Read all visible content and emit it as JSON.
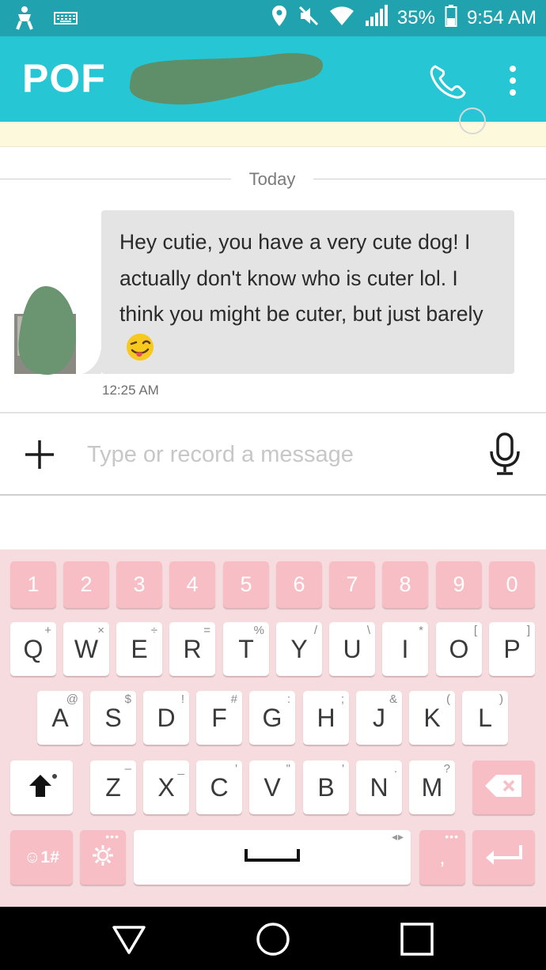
{
  "status_bar": {
    "battery": "35%",
    "time": "9:54 AM",
    "icons": [
      "figure-icon",
      "keyboard-icon",
      "location-icon",
      "mute-icon",
      "wifi-icon",
      "signal-icon",
      "battery-icon"
    ]
  },
  "app_bar": {
    "logo": "POF",
    "icons": [
      "phone-icon",
      "more-vert-icon"
    ]
  },
  "conversation": {
    "date_label": "Today",
    "messages": [
      {
        "text": "Hey cutie, you have a very cute dog! I actually don't know who is cuter lol. I think you might be cuter, but just barely",
        "emoji": "winking-face-with-tongue-emoji",
        "time": "12:25 AM"
      }
    ]
  },
  "compose": {
    "placeholder": "Type or record a message",
    "icons": [
      "plus-icon",
      "microphone-icon"
    ]
  },
  "keyboard": {
    "number_row": [
      "1",
      "2",
      "3",
      "4",
      "5",
      "6",
      "7",
      "8",
      "9",
      "0"
    ],
    "row1": [
      {
        "label": "Q",
        "hint": "+"
      },
      {
        "label": "W",
        "hint": "×"
      },
      {
        "label": "E",
        "hint": "÷"
      },
      {
        "label": "R",
        "hint": "="
      },
      {
        "label": "T",
        "hint": "%"
      },
      {
        "label": "Y",
        "hint": "/"
      },
      {
        "label": "U",
        "hint": "\\"
      },
      {
        "label": "I",
        "hint": "*"
      },
      {
        "label": "O",
        "hint": "["
      },
      {
        "label": "P",
        "hint": "]"
      }
    ],
    "row2": [
      {
        "label": "A",
        "hint": "@"
      },
      {
        "label": "S",
        "hint": "$"
      },
      {
        "label": "D",
        "hint": "!"
      },
      {
        "label": "F",
        "hint": "#"
      },
      {
        "label": "G",
        "hint": ":"
      },
      {
        "label": "H",
        "hint": ";"
      },
      {
        "label": "J",
        "hint": "&"
      },
      {
        "label": "K",
        "hint": "("
      },
      {
        "label": "L",
        "hint": ")"
      }
    ],
    "row3": [
      {
        "label": "Z",
        "hint": "–"
      },
      {
        "label": "X",
        "hint": "_"
      },
      {
        "label": "C",
        "hint": "'"
      },
      {
        "label": "V",
        "hint": "\""
      },
      {
        "label": "B",
        "hint": "'"
      },
      {
        "label": "N",
        "hint": "."
      },
      {
        "label": "M",
        "hint": "?"
      }
    ],
    "symbols_label": "☺1#",
    "comma_label": ",",
    "colors": {
      "background": "#f7dcdf",
      "pink_key": "#f7bec5",
      "white_key": "#ffffff"
    },
    "icons": [
      "shift-icon",
      "backspace-icon",
      "settings-icon",
      "spacebar-icon",
      "enter-icon"
    ]
  },
  "nav_bar": {
    "icons": [
      "back-icon",
      "home-icon",
      "recents-icon"
    ]
  },
  "colors": {
    "status_bar": "#20a3ae",
    "app_bar": "#26c6d4",
    "bubble": "#e4e4e4"
  }
}
